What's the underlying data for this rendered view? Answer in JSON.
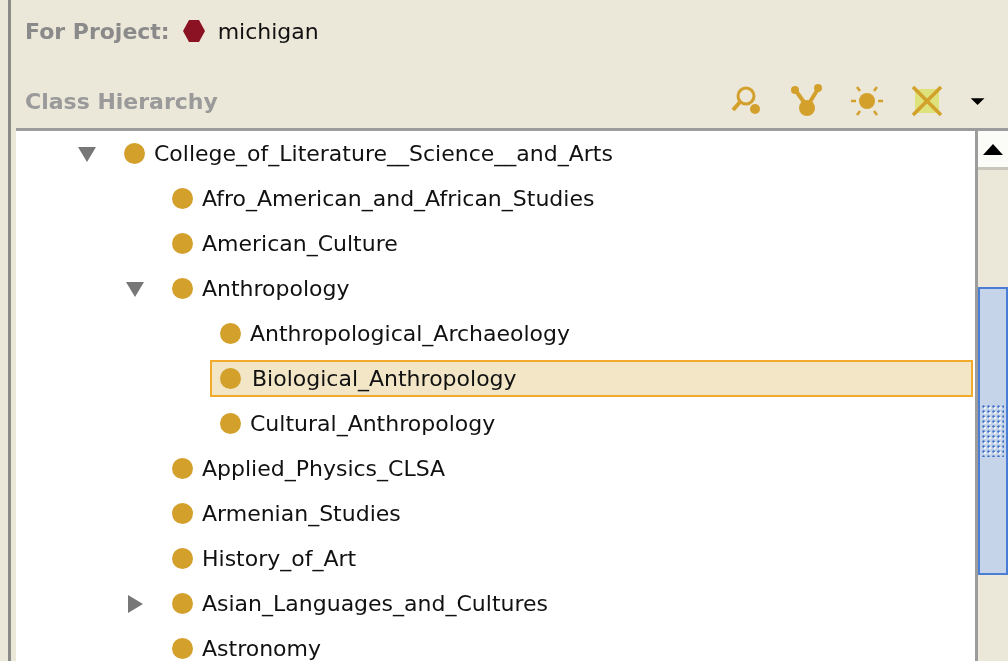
{
  "project": {
    "label": "For Project:",
    "name": "michigan"
  },
  "panel": {
    "title": "Class Hierarchy"
  },
  "tree": [
    {
      "label": "College_of_Literature__Science__and_Arts",
      "selected": false,
      "expanded": true,
      "children": [
        {
          "label": "Afro_American_and_African_Studies",
          "selected": false
        },
        {
          "label": "American_Culture",
          "selected": false
        },
        {
          "label": "Anthropology",
          "selected": false,
          "expanded": true,
          "children": [
            {
              "label": "Anthropological_Archaeology",
              "selected": false
            },
            {
              "label": "Biological_Anthropology",
              "selected": true
            },
            {
              "label": "Cultural_Anthropology",
              "selected": false
            }
          ]
        },
        {
          "label": "Applied_Physics_CLSA",
          "selected": false
        },
        {
          "label": "Armenian_Studies",
          "selected": false
        },
        {
          "label": "History_of_Art",
          "selected": false
        },
        {
          "label": "Asian_Languages_and_Cultures",
          "selected": false,
          "expanded": false
        },
        {
          "label": "Astronomy",
          "selected": false
        }
      ]
    }
  ]
}
